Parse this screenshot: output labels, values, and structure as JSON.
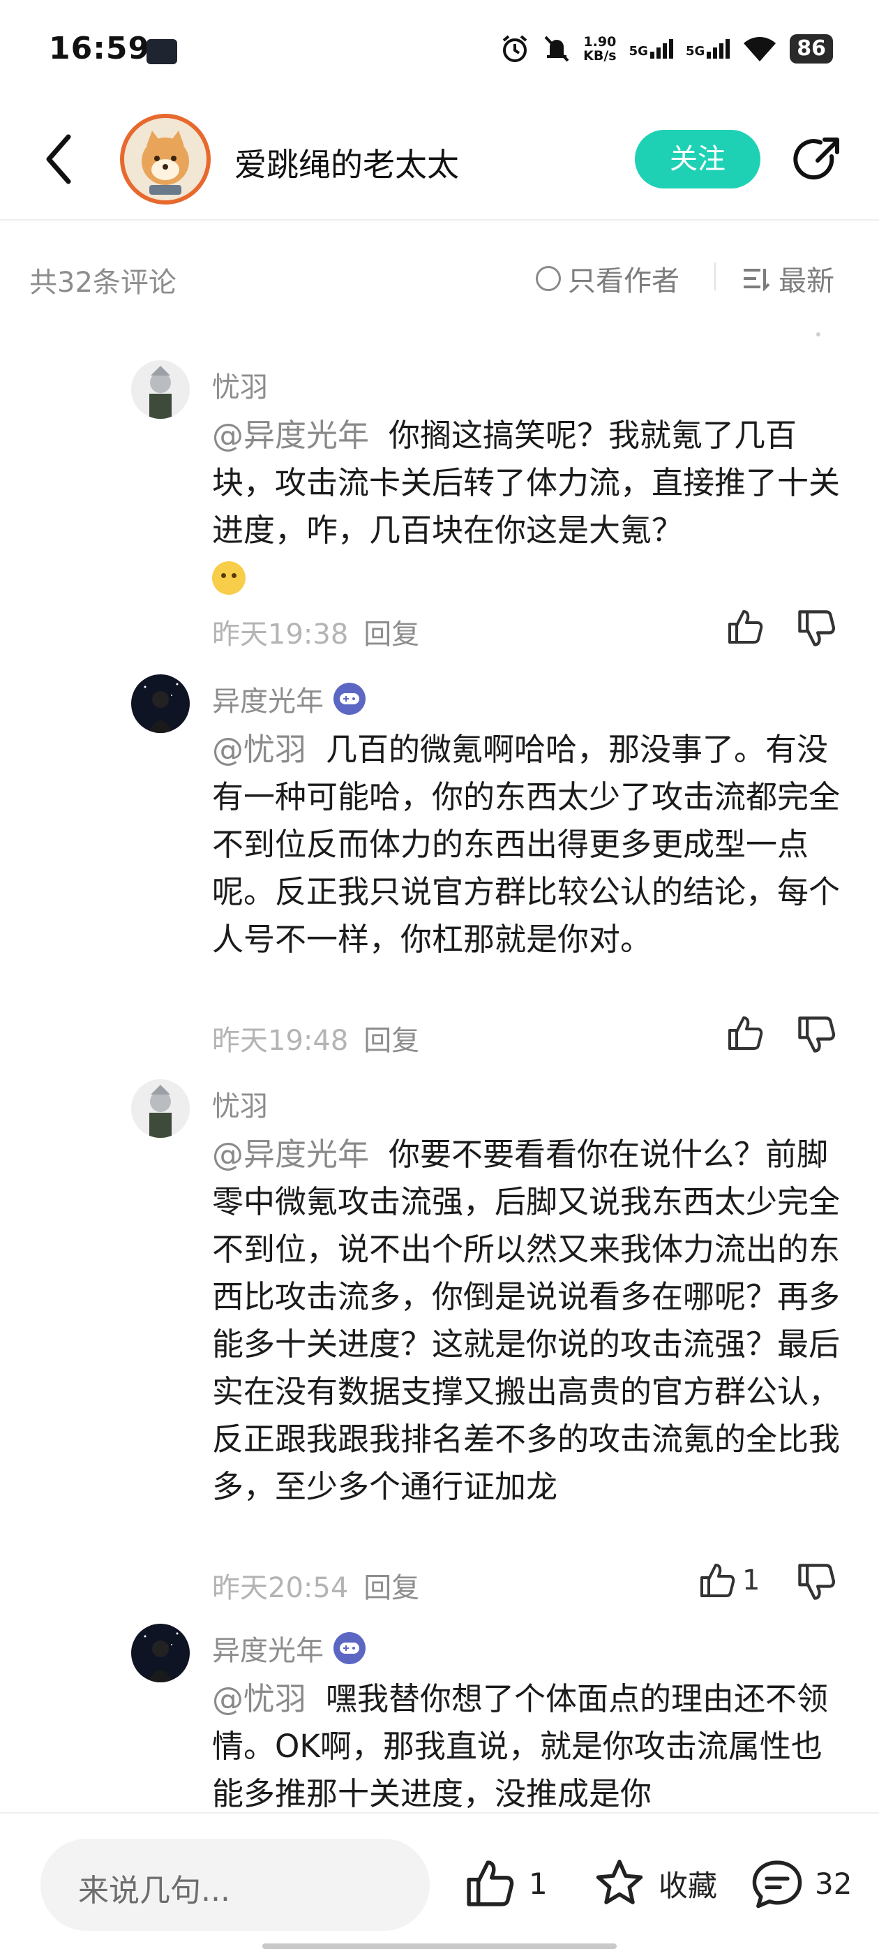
{
  "status_bar": {
    "time": "16:59",
    "net_speed_value": "1.90",
    "net_speed_unit": "KB/s",
    "sim1": "5G",
    "sim2": "5G",
    "battery": "86"
  },
  "header": {
    "author_name": "爱跳绳的老太太",
    "follow_label": "关注"
  },
  "filter": {
    "comment_count": "共32条评论",
    "only_author": "只看作者",
    "sort": "最新"
  },
  "replies": [
    {
      "name": "忧羽",
      "mention": "@异度光年",
      "text": "你搁这搞笑呢？我就氪了几百块，攻击流卡关后转了体力流，直接推了十关进度，咋，几百块在你这是大氪？",
      "time": "昨天19:38",
      "reply_label": "回复",
      "likes": ""
    },
    {
      "name": "异度光年",
      "mention": "@忧羽",
      "text": "几百的微氪啊哈哈，那没事了。有没有一种可能哈，你的东西太少了攻击流都完全不到位反而体力的东西出得更多更成型一点呢。反正我只说官方群比较公认的结论，每个人号不一样，你杠那就是你对。",
      "time": "昨天19:48",
      "reply_label": "回复",
      "likes": ""
    },
    {
      "name": "忧羽",
      "mention": "@异度光年",
      "text": "你要不要看看你在说什么？前脚零中微氪攻击流强，后脚又说我东西太少完全不到位，说不出个所以然又来我体力流出的东西比攻击流多，你倒是说说看多在哪呢？再多能多十关进度？这就是你说的攻击流强？最后实在没有数据支撑又搬出高贵的官方群公认，反正跟我跟我排名差不多的攻击流氪的全比我多，至少多个通行证加龙",
      "time": "昨天20:54",
      "reply_label": "回复",
      "likes": "1"
    },
    {
      "name": "异度光年",
      "mention": "@忧羽",
      "text": "嘿我替你想了个体面点的理由还不领情。OK啊，那我直说，就是你攻击流属性也能多推那十关进度，没推成是你",
      "time": "",
      "reply_label": "",
      "likes": ""
    }
  ],
  "bottom_bar": {
    "input_placeholder": "来说几句...",
    "like_count": "1",
    "fav_label": "收藏",
    "comment_count": "32"
  },
  "colors": {
    "accent": "#1fd1b4",
    "muted_text": "#8d8d8d",
    "badge": "#5c67c4"
  }
}
